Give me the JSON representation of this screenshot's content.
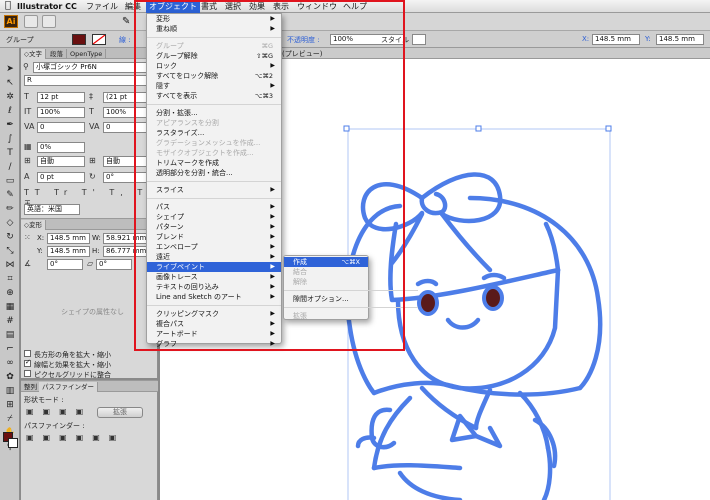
{
  "menubar": {
    "apple": "",
    "app": "Illustrator CC",
    "items": [
      "ファイル",
      "編集",
      "オブジェクト",
      "書式",
      "選択",
      "効果",
      "表示",
      "ウィンドウ",
      "ヘルプ"
    ]
  },
  "appbar": {
    "logo": "Ai"
  },
  "control": {
    "group_label": "グループ",
    "stroke_label": "線 :",
    "opacity_label": "不透明度 :",
    "opacity_value": "100%",
    "style_label": "スタイル :",
    "x_label": "X:",
    "x_value": "148.5 mm",
    "y_label": "Y:",
    "y_value": "148.5 mm"
  },
  "doctab": {
    "title": "(プレビュー)"
  },
  "char_panel": {
    "tabs": [
      "◇文字",
      "段落",
      "OpenType"
    ],
    "font": "小塚ゴシック Pr6N",
    "style": "R",
    "size": "12 pt",
    "leading": "(21 pt",
    "hscale": "100%",
    "vscale": "100%",
    "tracking": "0",
    "kerning": "0",
    "tsume": "0%",
    "aki1": "自動",
    "aki2": "自動",
    "baseline": "0 pt",
    "rotate": "0°",
    "lang": "英語：米国"
  },
  "transform_panel": {
    "tab": "◇変形",
    "x_label": "X:",
    "x_value": "148.5 mm",
    "w_label": "W:",
    "w_value": "58.921 mm",
    "y_label": "Y:",
    "y_value": "148.5 mm",
    "h_label": "H:",
    "h_value": "86.777 mm",
    "angle": "0°",
    "shear": "0°",
    "shape_props": "シェイプの属性なし",
    "opt1": "長方形の角を拡大・縮小",
    "opt2": "線幅と効果を拡大・縮小",
    "opt3": "ピクセルグリッドに整合"
  },
  "pathfinder_panel": {
    "tabs": [
      "整列",
      "パスファインダー"
    ],
    "shape_mode": "形状モード :",
    "expand": "拡張",
    "pathfinder": "パスファインダー :"
  },
  "object_menu": {
    "items": [
      {
        "label": "変形",
        "sc": "",
        "arrow": true,
        "disabled": false
      },
      {
        "label": "重ね順",
        "sc": "",
        "arrow": true,
        "disabled": false
      },
      {
        "sep": true
      },
      {
        "label": "グループ",
        "sc": "⌘G",
        "arrow": false,
        "disabled": true
      },
      {
        "label": "グループ解除",
        "sc": "⇧⌘G",
        "arrow": false,
        "disabled": false
      },
      {
        "label": "ロック",
        "sc": "",
        "arrow": true,
        "disabled": false
      },
      {
        "label": "すべてをロック解除",
        "sc": "⌥⌘2",
        "arrow": false,
        "disabled": false
      },
      {
        "label": "隠す",
        "sc": "",
        "arrow": true,
        "disabled": false
      },
      {
        "label": "すべてを表示",
        "sc": "⌥⌘3",
        "arrow": false,
        "disabled": false
      },
      {
        "sep": true
      },
      {
        "label": "分割・拡張...",
        "sc": "",
        "arrow": false,
        "disabled": false
      },
      {
        "label": "アピアランスを分割",
        "sc": "",
        "arrow": false,
        "disabled": true
      },
      {
        "label": "ラスタライズ...",
        "sc": "",
        "arrow": false,
        "disabled": false
      },
      {
        "label": "グラデーションメッシュを作成...",
        "sc": "",
        "arrow": false,
        "disabled": true
      },
      {
        "label": "モザイクオブジェクトを作成...",
        "sc": "",
        "arrow": false,
        "disabled": true
      },
      {
        "label": "トリムマークを作成",
        "sc": "",
        "arrow": false,
        "disabled": false
      },
      {
        "label": "透明部分を分割・統合...",
        "sc": "",
        "arrow": false,
        "disabled": false
      },
      {
        "sep": true
      },
      {
        "label": "スライス",
        "sc": "",
        "arrow": true,
        "disabled": false
      },
      {
        "sep": true
      },
      {
        "label": "パス",
        "sc": "",
        "arrow": true,
        "disabled": false
      },
      {
        "label": "シェイプ",
        "sc": "",
        "arrow": true,
        "disabled": false
      },
      {
        "label": "パターン",
        "sc": "",
        "arrow": true,
        "disabled": false
      },
      {
        "label": "ブレンド",
        "sc": "",
        "arrow": true,
        "disabled": false
      },
      {
        "label": "エンベロープ",
        "sc": "",
        "arrow": true,
        "disabled": false
      },
      {
        "label": "遠近",
        "sc": "",
        "arrow": true,
        "disabled": false
      },
      {
        "label": "ライブペイント",
        "sc": "",
        "arrow": true,
        "disabled": false,
        "highlight": true
      },
      {
        "label": "画像トレース",
        "sc": "",
        "arrow": true,
        "disabled": false
      },
      {
        "label": "テキストの回り込み",
        "sc": "",
        "arrow": true,
        "disabled": false
      },
      {
        "label": "Line and Sketch のアート",
        "sc": "",
        "arrow": true,
        "disabled": false
      },
      {
        "sep": true
      },
      {
        "label": "クリッピングマスク",
        "sc": "",
        "arrow": true,
        "disabled": false
      },
      {
        "label": "複合パス",
        "sc": "",
        "arrow": true,
        "disabled": false
      },
      {
        "label": "アートボード",
        "sc": "",
        "arrow": true,
        "disabled": false
      },
      {
        "label": "グラフ",
        "sc": "",
        "arrow": true,
        "disabled": false
      }
    ]
  },
  "livepaint_submenu": {
    "items": [
      {
        "label": "作成",
        "sc": "⌥⌘X",
        "disabled": false,
        "highlight": true
      },
      {
        "label": "結合",
        "sc": "",
        "disabled": true
      },
      {
        "label": "解除",
        "sc": "",
        "disabled": true
      },
      {
        "sep": true
      },
      {
        "label": "隙間オプション...",
        "sc": "",
        "disabled": false
      },
      {
        "sep": true
      },
      {
        "label": "拡張",
        "sc": "",
        "disabled": true
      }
    ]
  },
  "colors": {
    "accent": "#2f63d8",
    "stroke_blue": "#4d7de8",
    "eye": "#5a1a1a",
    "highlight_box": "#e0141e"
  }
}
